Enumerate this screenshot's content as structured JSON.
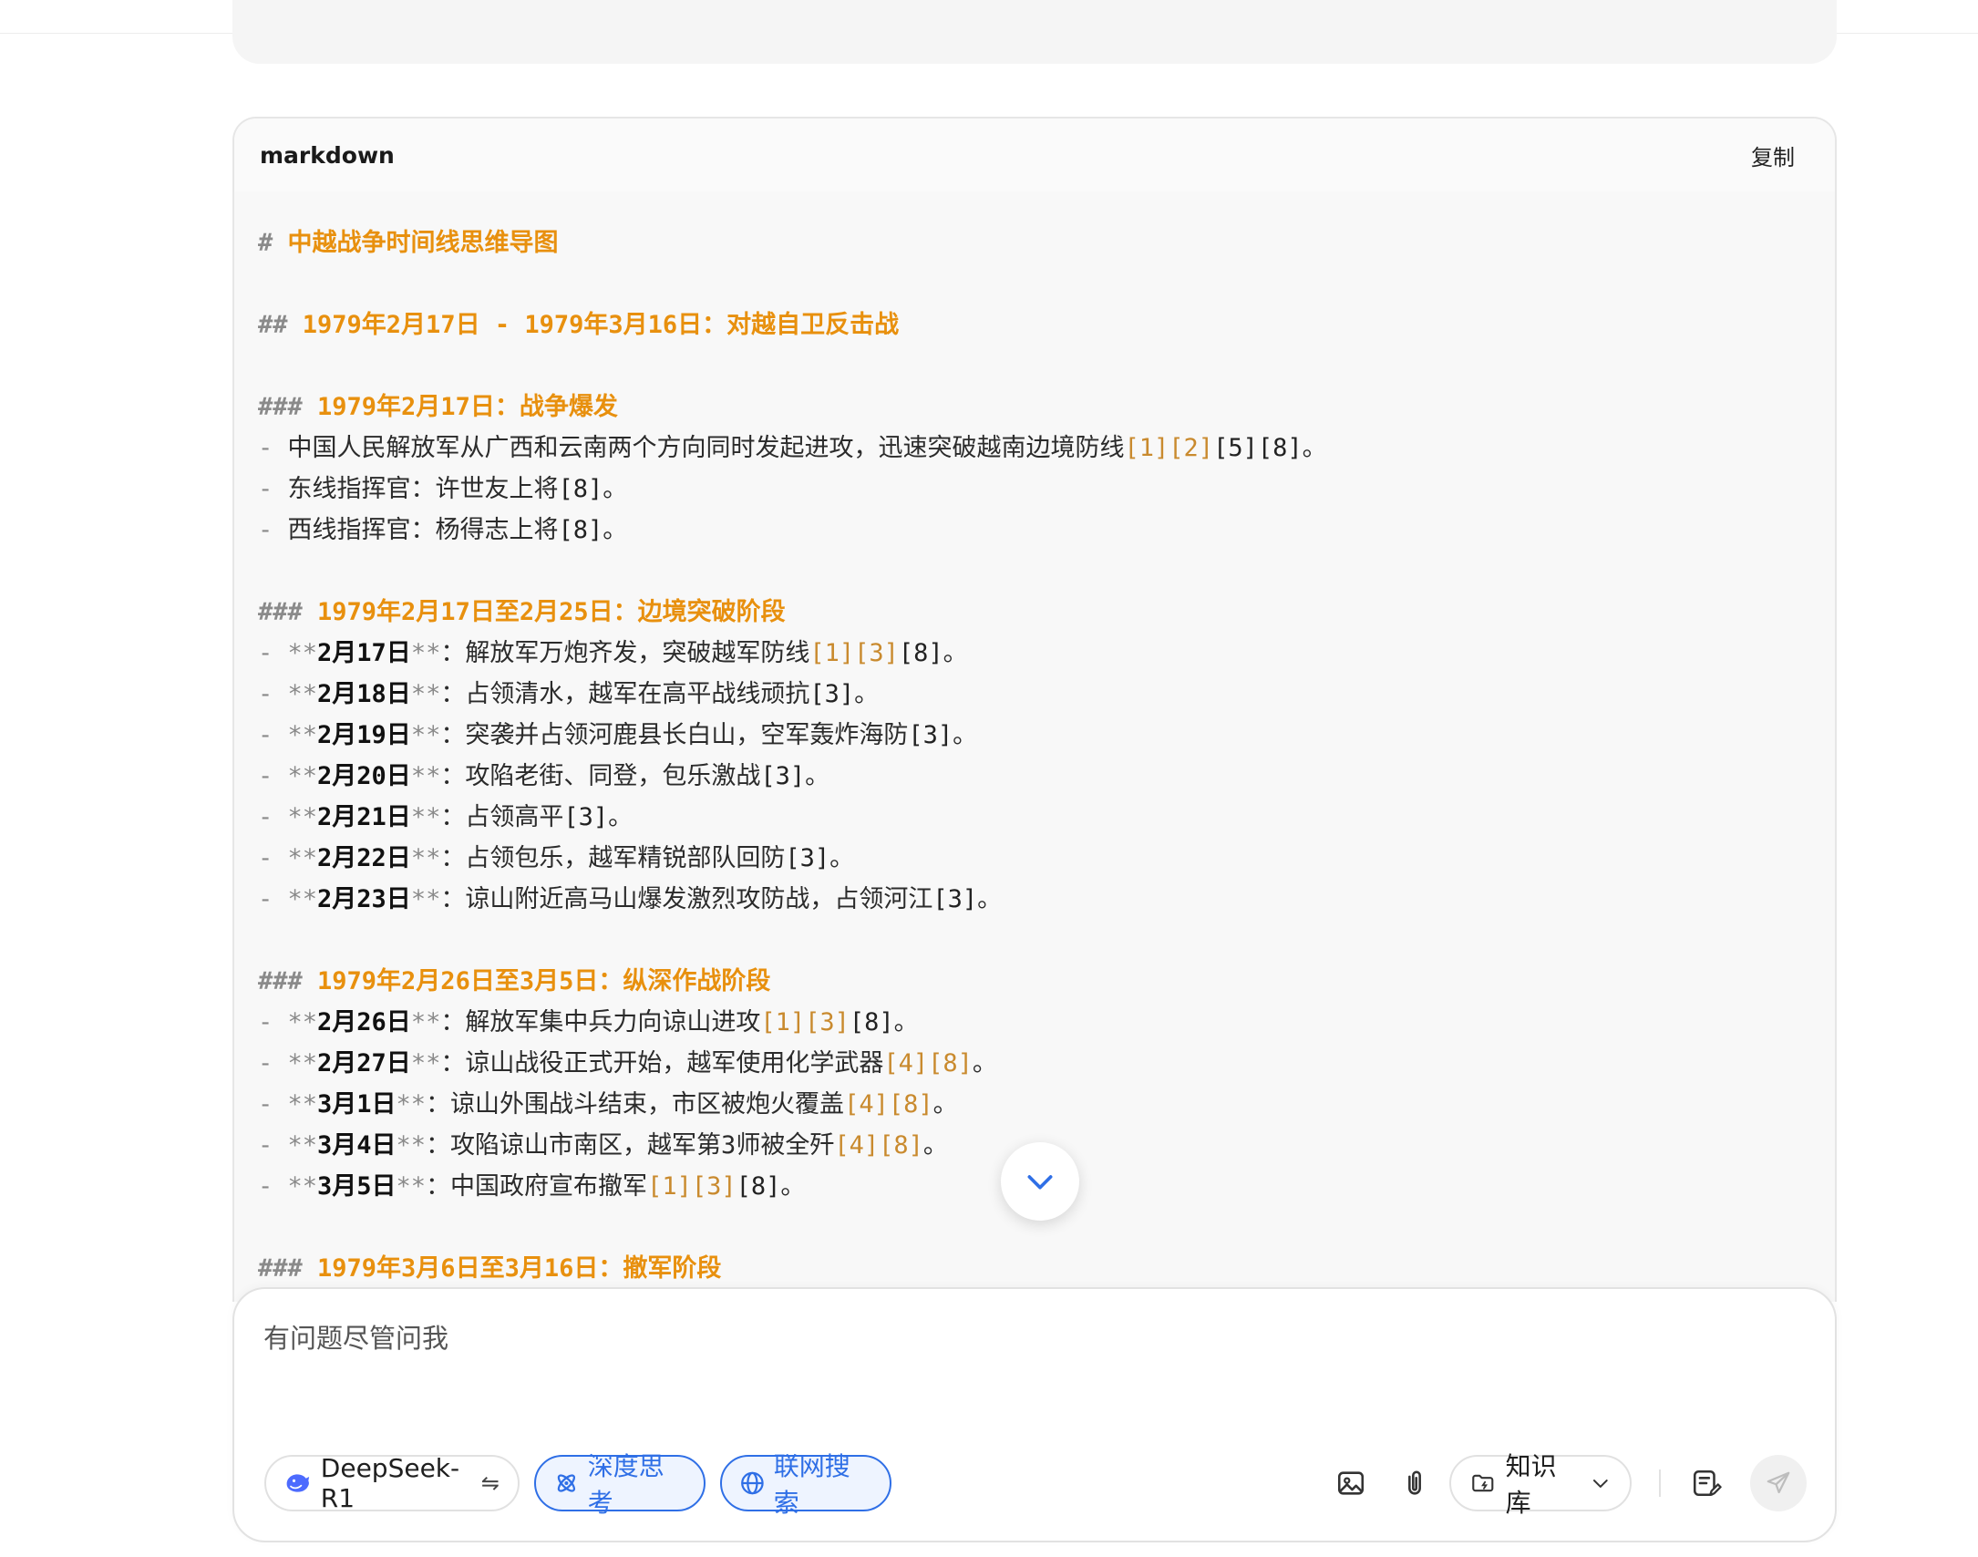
{
  "code_block": {
    "language": "markdown",
    "copy_label": "复制",
    "lines": [
      {
        "type": "heading",
        "marker": "#",
        "text": "中越战争时间线思维导图"
      },
      {
        "type": "blank"
      },
      {
        "type": "heading",
        "marker": "##",
        "text": "1979年2月17日 - 1979年3月16日：对越自卫反击战"
      },
      {
        "type": "blank"
      },
      {
        "type": "heading",
        "marker": "###",
        "text": "1979年2月17日：战争爆发"
      },
      {
        "type": "item",
        "text": "中国人民解放军从广西和云南两个方向同时发起进攻，迅速突破越南边境防线",
        "refs": [
          {
            "t": "[1]",
            "link": true
          },
          {
            "t": "[2]",
            "link": true
          },
          {
            "t": "[5]",
            "link": false
          },
          {
            "t": "[8]",
            "link": false
          }
        ],
        "end": "。"
      },
      {
        "type": "item",
        "text": "东线指挥官：许世友上将",
        "refs": [
          {
            "t": "[8]",
            "link": false
          }
        ],
        "end": "。"
      },
      {
        "type": "item",
        "text": "西线指挥官：杨得志上将",
        "refs": [
          {
            "t": "[8]",
            "link": false
          }
        ],
        "end": "。"
      },
      {
        "type": "blank"
      },
      {
        "type": "heading",
        "marker": "###",
        "text": "1979年2月17日至2月25日：边境突破阶段"
      },
      {
        "type": "item",
        "date": "2月17日",
        "text": "：解放军万炮齐发，突破越军防线",
        "refs": [
          {
            "t": "[1]",
            "link": true
          },
          {
            "t": "[3]",
            "link": true
          },
          {
            "t": "[8]",
            "link": false
          }
        ],
        "end": "。"
      },
      {
        "type": "item",
        "date": "2月18日",
        "text": "：占领清水，越军在高平战线顽抗",
        "refs": [
          {
            "t": "[3]",
            "link": false
          }
        ],
        "end": "。"
      },
      {
        "type": "item",
        "date": "2月19日",
        "text": "：突袭并占领河鹿县长白山，空军轰炸海防",
        "refs": [
          {
            "t": "[3]",
            "link": false
          }
        ],
        "end": "。"
      },
      {
        "type": "item",
        "date": "2月20日",
        "text": "：攻陷老街、同登，包乐激战",
        "refs": [
          {
            "t": "[3]",
            "link": false
          }
        ],
        "end": "。"
      },
      {
        "type": "item",
        "date": "2月21日",
        "text": "：占领高平",
        "refs": [
          {
            "t": "[3]",
            "link": false
          }
        ],
        "end": "。"
      },
      {
        "type": "item",
        "date": "2月22日",
        "text": "：占领包乐，越军精锐部队回防",
        "refs": [
          {
            "t": "[3]",
            "link": false
          }
        ],
        "end": "。"
      },
      {
        "type": "item",
        "date": "2月23日",
        "text": "：谅山附近高马山爆发激烈攻防战，占领河江",
        "refs": [
          {
            "t": "[3]",
            "link": false
          }
        ],
        "end": "。"
      },
      {
        "type": "blank"
      },
      {
        "type": "heading",
        "marker": "###",
        "text": "1979年2月26日至3月5日：纵深作战阶段"
      },
      {
        "type": "item",
        "date": "2月26日",
        "text": "：解放军集中兵力向谅山进攻",
        "refs": [
          {
            "t": "[1]",
            "link": true
          },
          {
            "t": "[3]",
            "link": true
          },
          {
            "t": "[8]",
            "link": false
          }
        ],
        "end": "。"
      },
      {
        "type": "item",
        "date": "2月27日",
        "text": "：谅山战役正式开始，越军使用化学武器",
        "refs": [
          {
            "t": "[4]",
            "link": true
          },
          {
            "t": "[8]",
            "link": true
          }
        ],
        "end": "。"
      },
      {
        "type": "item",
        "date": "3月1日",
        "text": "：谅山外围战斗结束，市区被炮火覆盖",
        "refs": [
          {
            "t": "[4]",
            "link": true
          },
          {
            "t": "[8]",
            "link": true
          }
        ],
        "end": "。"
      },
      {
        "type": "item",
        "date": "3月4日",
        "text": "：攻陷谅山市南区，越军第3师被全歼",
        "refs": [
          {
            "t": "[4]",
            "link": true
          },
          {
            "t": "[8]",
            "link": true
          }
        ],
        "end": "。"
      },
      {
        "type": "item",
        "date": "3月5日",
        "text": "：中国政府宣布撤军",
        "refs": [
          {
            "t": "[1]",
            "link": true
          },
          {
            "t": "[3]",
            "link": true
          },
          {
            "t": "[8]",
            "link": false
          }
        ],
        "end": "。"
      },
      {
        "type": "blank"
      },
      {
        "type": "heading",
        "marker": "###",
        "text": "1979年3月6日至3月16日：撤军阶段"
      }
    ]
  },
  "composer": {
    "placeholder": "有问题尽管问我",
    "model_label": "DeepSeek-R1",
    "model_swap_glyph": "⇋",
    "deep_think_label": "深度思考",
    "web_search_label": "联网搜索",
    "knowledge_base_label": "知识库"
  },
  "colors": {
    "heading": "#e8900e",
    "accent": "#2f6fe6",
    "ref_link": "#c98a2e"
  }
}
